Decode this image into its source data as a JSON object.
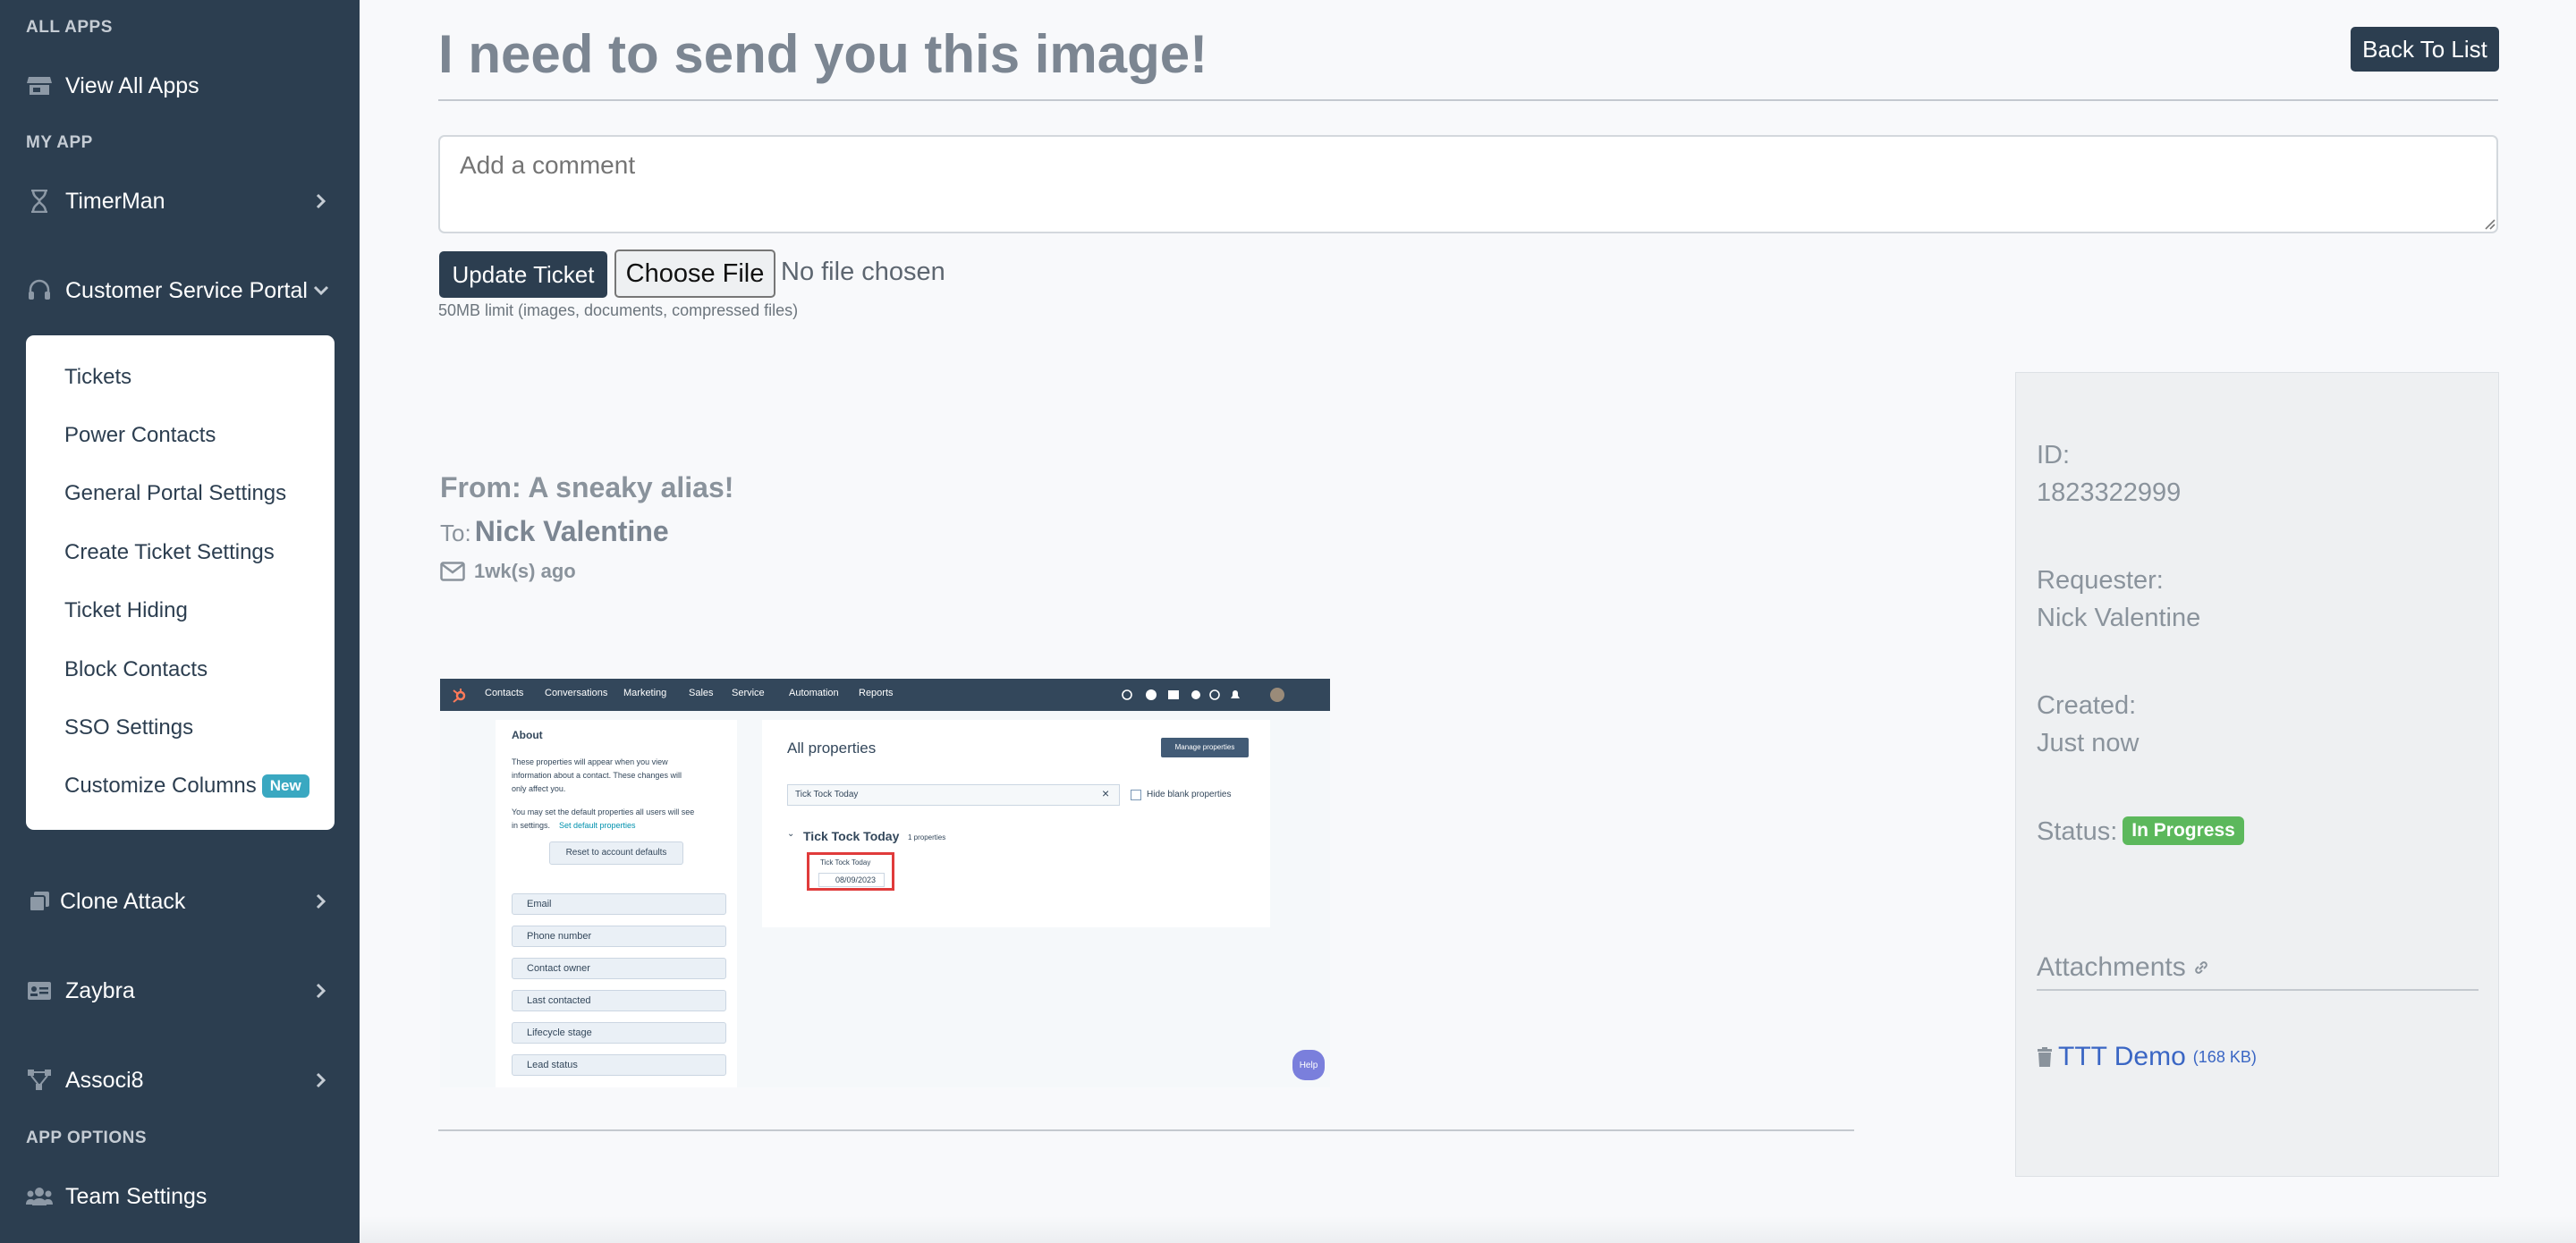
{
  "sidebar": {
    "all_apps_heading": "ALL APPS",
    "view_all_apps": "View All Apps",
    "my_app_heading": "MY APP",
    "timerman": "TimerMan",
    "customer_service_portal": "Customer Service Portal",
    "submenu": [
      {
        "label": "Tickets"
      },
      {
        "label": "Power Contacts"
      },
      {
        "label": "General Portal Settings"
      },
      {
        "label": "Create Ticket Settings"
      },
      {
        "label": "Ticket Hiding"
      },
      {
        "label": "Block Contacts"
      },
      {
        "label": "SSO Settings"
      },
      {
        "label": "Customize Columns",
        "badge": "New"
      }
    ],
    "clone_attack": "Clone Attack",
    "zaybra": "Zaybra",
    "associ8": "Associ8",
    "app_options_heading": "APP OPTIONS",
    "team_settings": "Team Settings"
  },
  "ticket": {
    "title": "I need to send you this image!",
    "back_button": "Back To List",
    "comment_placeholder": "Add a comment",
    "update_button": "Update Ticket",
    "choose_file_button": "Choose File",
    "file_status": "No file chosen",
    "limit_note": "50MB limit (images, documents, compressed files)"
  },
  "message": {
    "from": "From: A sneaky alias!",
    "to_label": "To:",
    "to_name": "Nick Valentine",
    "age": "1wk(s) ago"
  },
  "embedded_image": {
    "nav": [
      "Contacts",
      "Conversations",
      "Marketing",
      "Sales",
      "Service",
      "Automation",
      "Reports"
    ],
    "about_title": "About",
    "about_text_1": "These properties will appear when you view",
    "about_text_2": "information about a contact. These changes will",
    "about_text_3": "only affect you.",
    "about_text_4": "You may set the default properties all users will see",
    "about_text_5": "in settings.",
    "about_link": "Set default properties",
    "reset_button": "Reset to account defaults",
    "property_rows": [
      "Email",
      "Phone number",
      "Contact owner",
      "Last contacted",
      "Lifecycle stage",
      "Lead status"
    ],
    "all_properties_title": "All properties",
    "manage_button": "Manage properties",
    "search_value": "Tick Tock Today",
    "hide_blank": "Hide blank properties",
    "group_name": "Tick Tock Today",
    "group_count": "1 properties",
    "field_label": "Tick Tock Today",
    "field_value": "08/09/2023",
    "help": "Help"
  },
  "info": {
    "id_label": "ID:",
    "id_value": "1823322999",
    "requester_label": "Requester:",
    "requester_value": "Nick Valentine",
    "created_label": "Created:",
    "created_value": "Just now",
    "status_label": "Status:",
    "status_value": "In Progress",
    "attachments_label": "Attachments",
    "attachment_name": "TTT Demo",
    "attachment_size": "(168 KB)"
  },
  "colors": {
    "sidebar_bg": "#2c3e50",
    "primary_button": "#2c3e50",
    "status_green": "#5cb85c",
    "new_badge": "#3aa8c1",
    "link_blue": "#3a66c4"
  }
}
